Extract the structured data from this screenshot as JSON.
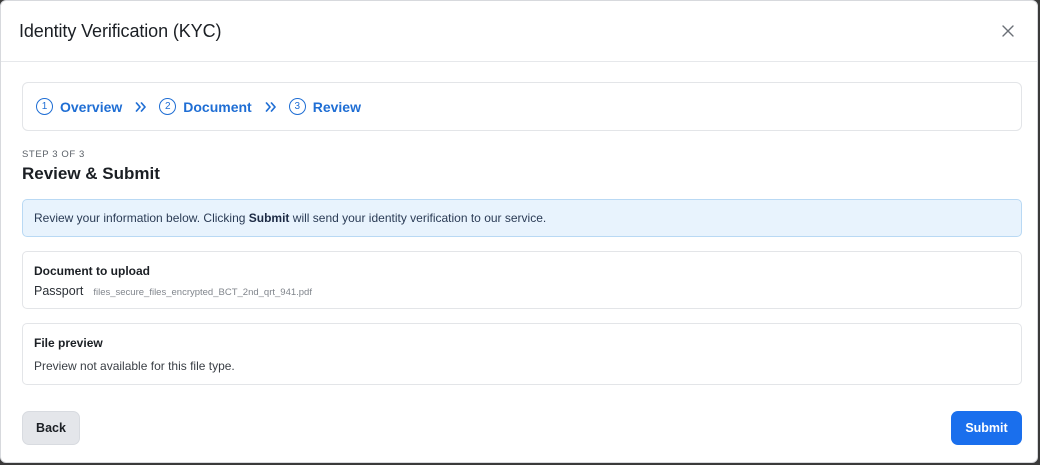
{
  "modal": {
    "title": "Identity Verification (KYC)"
  },
  "stepper": {
    "steps": [
      {
        "number": "1",
        "label": "Overview"
      },
      {
        "number": "2",
        "label": "Document"
      },
      {
        "number": "3",
        "label": "Review"
      }
    ]
  },
  "section": {
    "eyebrow": "STEP 3 OF 3",
    "title": "Review & Submit"
  },
  "info": {
    "text_before": "Review your information below. Clicking ",
    "bold": "Submit",
    "text_after": " will send your identity verification to our service."
  },
  "document_card": {
    "title": "Document to upload",
    "doc_type": "Passport",
    "file_name": "files_secure_files_encrypted_BCT_2nd_qrt_941.pdf"
  },
  "preview_card": {
    "title": "File preview",
    "message": "Preview not available for this file type."
  },
  "actions": {
    "back_label": "Back",
    "submit_label": "Submit"
  },
  "colors": {
    "accent": "#1f6ed4",
    "primary_button": "#1a6fed",
    "info_bg": "#e8f3fd",
    "info_border": "#b9d9f4"
  },
  "icons": {
    "close": "close-icon",
    "separator": "double-chevron-right-icon"
  }
}
